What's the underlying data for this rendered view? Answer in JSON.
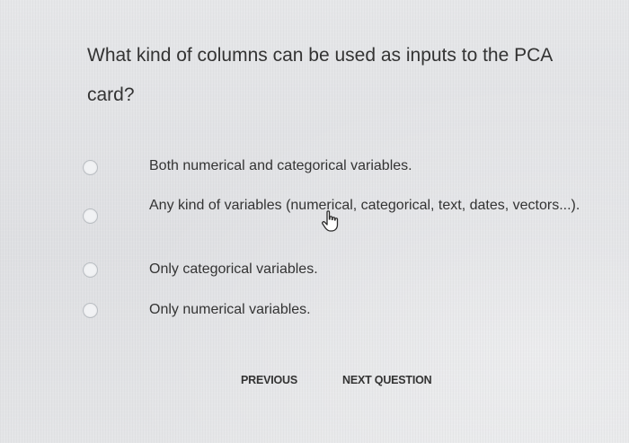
{
  "question": {
    "text": "What kind of columns can be used as inputs to the PCA card?"
  },
  "options": [
    {
      "label": "Both numerical and categorical variables."
    },
    {
      "label": "Any kind of variables (numerical, categorical, text, dates, vectors...)."
    },
    {
      "label": "Only categorical variables."
    },
    {
      "label": "Only numerical variables."
    }
  ],
  "nav": {
    "previous_label": "PREVIOUS",
    "next_label": "NEXT QUESTION"
  },
  "icons": {
    "radio": "radio-unchecked-icon",
    "cursor": "hand-pointer-icon"
  }
}
